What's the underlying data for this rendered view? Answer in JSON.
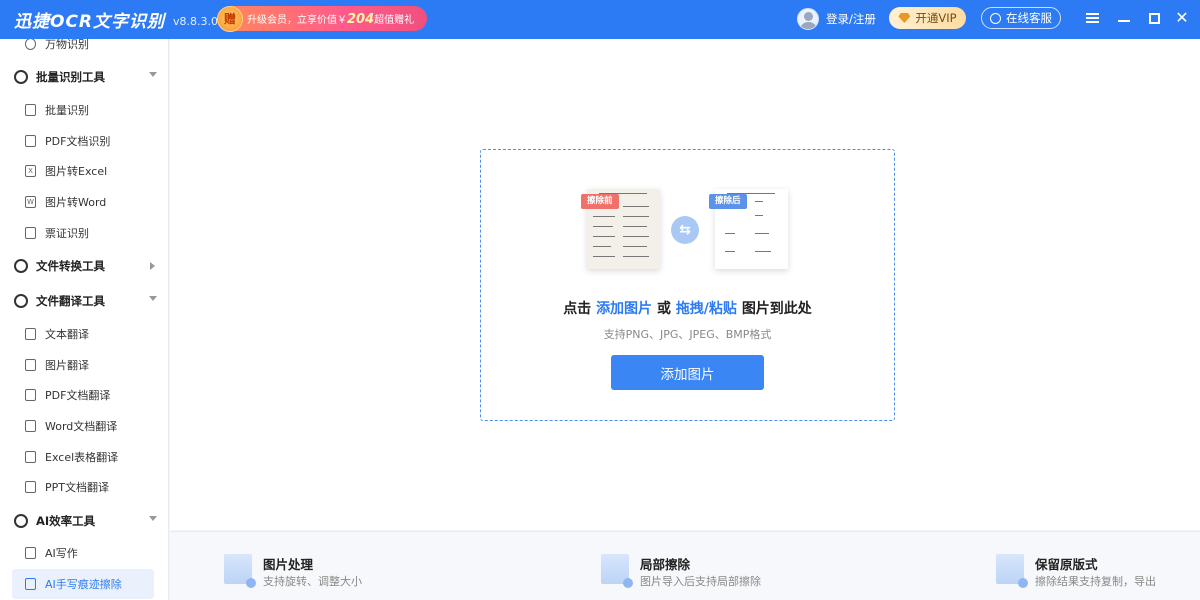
{
  "titlebar": {
    "app_name": "迅捷OCR文字识别",
    "version": "v8.8.3.0",
    "promo_text_a": "升级会员，立享价值￥",
    "promo_number": "204",
    "promo_text_b": "超值赠礼",
    "promo_badge": "赠",
    "login": "登录/注册",
    "vip": "开通VIP",
    "service": "在线客服",
    "close_glyph": "✕"
  },
  "sidebar": {
    "top_item": "万物识别",
    "groups": [
      {
        "label": "批量识别工具",
        "items": [
          "批量识别",
          "PDF文档识别",
          "图片转Excel",
          "图片转Word",
          "票证识别"
        ]
      },
      {
        "label": "文件转换工具",
        "items": []
      },
      {
        "label": "文件翻译工具",
        "items": [
          "文本翻译",
          "图片翻译",
          "PDF文档翻译",
          "Word文档翻译",
          "Excel表格翻译",
          "PPT文档翻译"
        ]
      },
      {
        "label": "AI效率工具",
        "items": [
          "AI写作",
          "AI手写痕迹擦除"
        ]
      }
    ],
    "icon_glyphs": {
      "excel": "X",
      "word": "W"
    }
  },
  "dropzone": {
    "before_tag": "擦除前",
    "after_tag": "擦除后",
    "title_prefix": "点击",
    "title_hl1": "添加图片",
    "title_or": "或",
    "title_hl2": "拖拽/粘贴",
    "title_suffix": "图片到此处",
    "subtitle": "支持PNG、JPG、JPEG、BMP格式",
    "button": "添加图片"
  },
  "features": [
    {
      "title": "图片处理",
      "desc": "支持旋转、调整大小"
    },
    {
      "title": "局部擦除",
      "desc": "图片导入后支持局部擦除"
    },
    {
      "title": "保留原版式",
      "desc": "擦除结果支持复制，导出"
    }
  ],
  "colors": {
    "primary": "#2d7bf4",
    "tag_before": "#f0706a",
    "tag_after": "#5b93e8"
  }
}
